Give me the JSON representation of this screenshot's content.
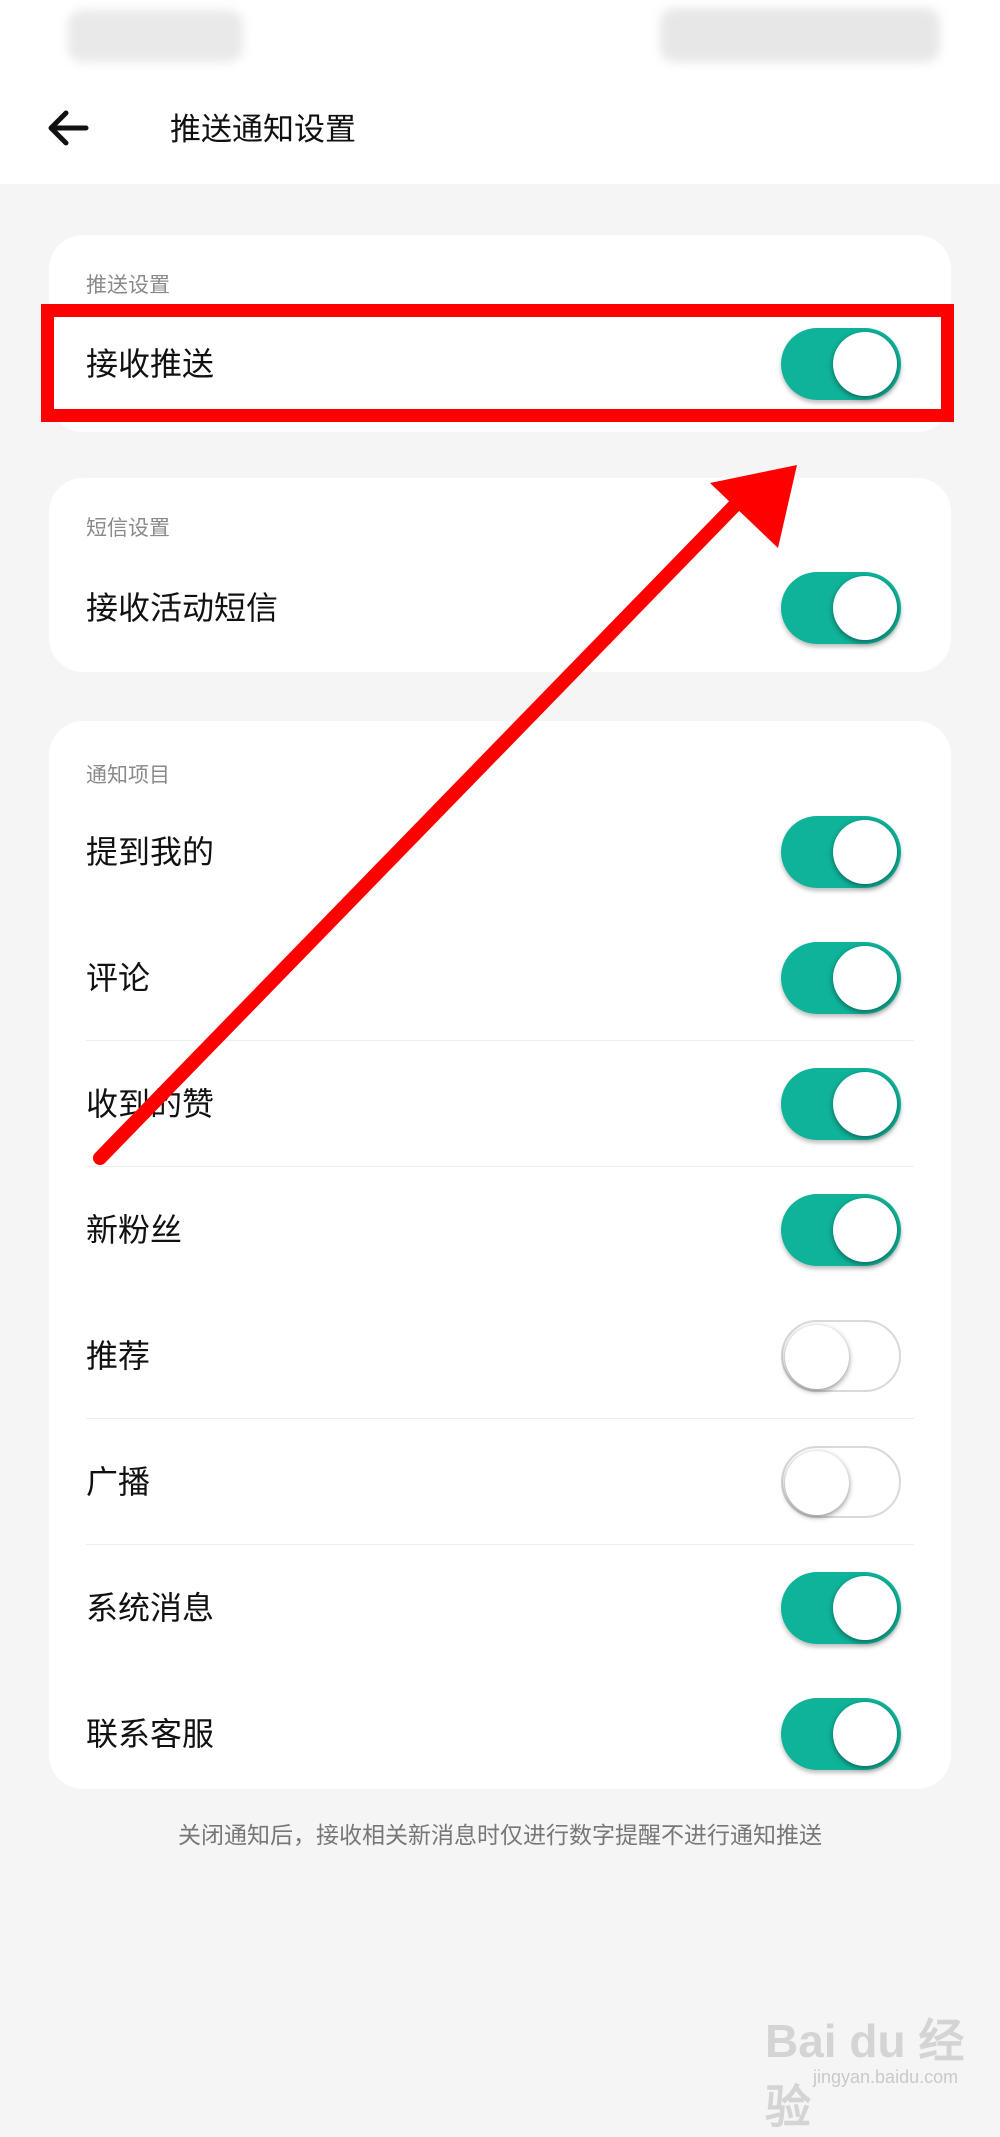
{
  "header": {
    "title": "推送通知设置",
    "back_icon": "back-arrow-icon"
  },
  "sections": {
    "push": {
      "header": "推送设置",
      "items": [
        {
          "label": "接收推送",
          "on": true
        }
      ]
    },
    "sms": {
      "header": "短信设置",
      "items": [
        {
          "label": "接收活动短信",
          "on": true
        }
      ]
    },
    "notify": {
      "header": "通知项目",
      "items": [
        {
          "label": "提到我的",
          "on": true
        },
        {
          "label": "评论",
          "on": true
        },
        {
          "label": "收到的赞",
          "on": true
        },
        {
          "label": "新粉丝",
          "on": true
        },
        {
          "label": "推荐",
          "on": false
        },
        {
          "label": "广播",
          "on": false
        },
        {
          "label": "系统消息",
          "on": true
        },
        {
          "label": "联系客服",
          "on": true
        }
      ]
    }
  },
  "footer_note": "关闭通知后，接收相关新消息时仅进行数字提醒不进行通知推送",
  "annotation": {
    "highlight_color": "#ff0000",
    "arrow_color": "#ff0000"
  },
  "watermark": {
    "brand": "Bai du 经验",
    "sub": "jingyan.baidu.com"
  },
  "colors": {
    "toggle_on": "#0fb39a",
    "toggle_off": "#ffffff",
    "page_bg": "#f5f5f5"
  }
}
